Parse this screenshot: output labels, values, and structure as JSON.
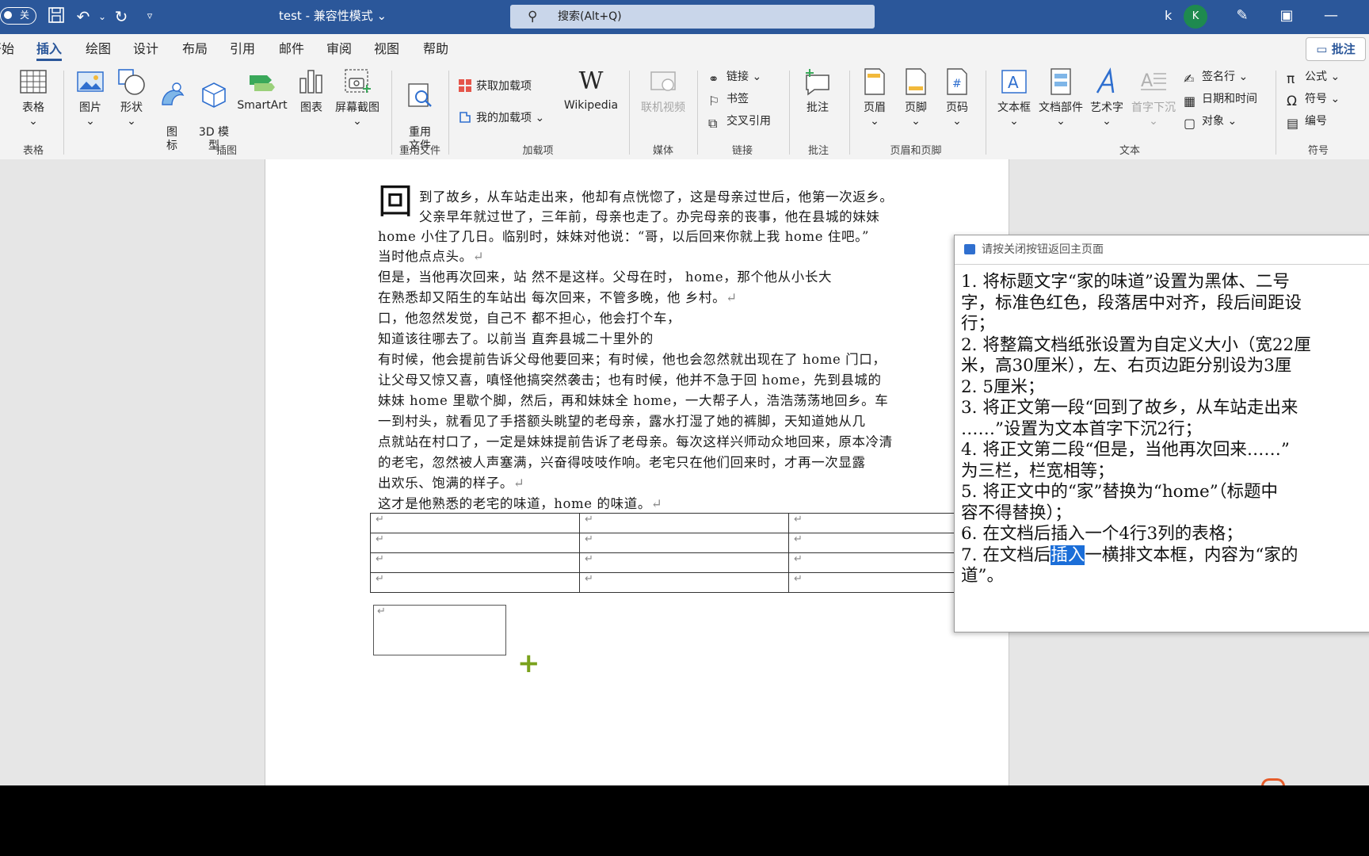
{
  "titlebar": {
    "autosave_label": "关",
    "doc_title": "test  -  兼容性模式  ⌄",
    "search_placeholder": "搜索(Alt+Q)",
    "user_initial_text": "k",
    "avatar_initial": "K",
    "color": "#2b579a"
  },
  "tabs": {
    "items": [
      "开始",
      "插入",
      "绘图",
      "设计",
      "布局",
      "引用",
      "邮件",
      "审阅",
      "视图",
      "帮助"
    ],
    "comment_button": "批注"
  },
  "ribbon": {
    "table": {
      "label": "表格",
      "group": "表格"
    },
    "illustrations": {
      "picture": "图片",
      "shapes": "形状",
      "icons": "图\n标",
      "model3d": "3D 模\n型",
      "smartart": "SmartArt",
      "chart": "图表",
      "screenshot": "屏幕截图",
      "group": "插图"
    },
    "reuse": {
      "label": "重用\n文件",
      "group": "重用文件"
    },
    "addins": {
      "get": "获取加载项",
      "mine": "我的加载项",
      "wikipedia": "Wikipedia",
      "group": "加载项"
    },
    "media": {
      "online_video": "联机视频",
      "group": "媒体"
    },
    "links": {
      "link": "链接",
      "bookmark": "书签",
      "crossref": "交叉引用",
      "group": "链接"
    },
    "comments": {
      "label": "批注",
      "group": "批注"
    },
    "headerfooter": {
      "header": "页眉",
      "footer": "页脚",
      "pagenum": "页码",
      "group": "页眉和页脚"
    },
    "text": {
      "textbox": "文本框",
      "quickparts": "文档部件",
      "wordart": "艺术字",
      "dropcap": "首字下沉",
      "signature": "签名行",
      "datetime": "日期和时间",
      "object": "对象",
      "group": "文本"
    },
    "symbols": {
      "equation": "公式",
      "symbol": "符号",
      "numbering": "编号",
      "group": "符号"
    }
  },
  "document": {
    "dropcap_char": "回",
    "lines": [
      "到了故乡，从车站走出来，他却有点恍惚了，这是母亲过世后，他第一次返乡。",
      "父亲早年就过世了，三年前，母亲也走了。办完母亲的丧事，他在县城的妹妹",
      "home 小住了几日。临别时，妹妹对他说：“哥，以后回来你就上我 home 住吧。”",
      "当时他点点头。",
      "但是，当他再次回来，站      然不是这样。父母在时，      home，那个他从小长大",
      "在熟悉却又陌生的车站出      每次回来，不管多晚，他      乡村。",
      "口，他忽然发觉，自己不      都不担心，他会打个车，",
      "知道该往哪去了。以前当      直奔县城二十里外的",
      "有时候，他会提前告诉父母他要回来；有时候，他也会忽然就出现在了 home 门口，",
      "让父母又惊又喜，嗔怪他搞突然袭击；也有时候，他并不急于回 home，先到县城的",
      "妹妹 home 里歇个脚，然后，再和妹妹全 home，一大帮子人，浩浩荡荡地回乡。车",
      "一到村头，就看见了手搭额头眺望的老母亲，露水打湿了她的裤脚，天知道她从几",
      "点就站在村口了，一定是妹妹提前告诉了老母亲。每次这样兴师动众地回来，原本冷清",
      "的老宅，忽然被人声塞满，兴奋得吱吱作响。老宅只在他们回来时，才再一次显露",
      "出欢乐、饱满的样子。",
      "这才是他熟悉的老宅的味道，home 的味道。"
    ],
    "paragraph_mark": "↵"
  },
  "panel": {
    "header": "请按关闭按钮返回主页面",
    "lines": [
      "1. 将标题文字“家的味道”设置为黑体、二号",
      "字，标准色红色，段落居中对齐，段后间距设",
      "行；",
      "2. 将整篇文档纸张设置为自定义大小（宽22厘",
      "米，高30厘米），左、右页边距分别设为3厘",
      "2. 5厘米；",
      "3. 将正文第一段“回到了故乡，从车站走出来",
      "……”设置为文本首字下沉2行；",
      "4. 将正文第二段“但是，当他再次回来……”",
      "为三栏，栏宽相等；",
      "5. 将正文中的“家”替换为“home”（标题中",
      "容不得替换）；",
      "6. 在文档后插入一个4行3列的表格；",
      "7. 在文档后",
      "道”。"
    ],
    "line13_selected": "插入",
    "line13_after": "一横排文本框，内容为“家的"
  }
}
